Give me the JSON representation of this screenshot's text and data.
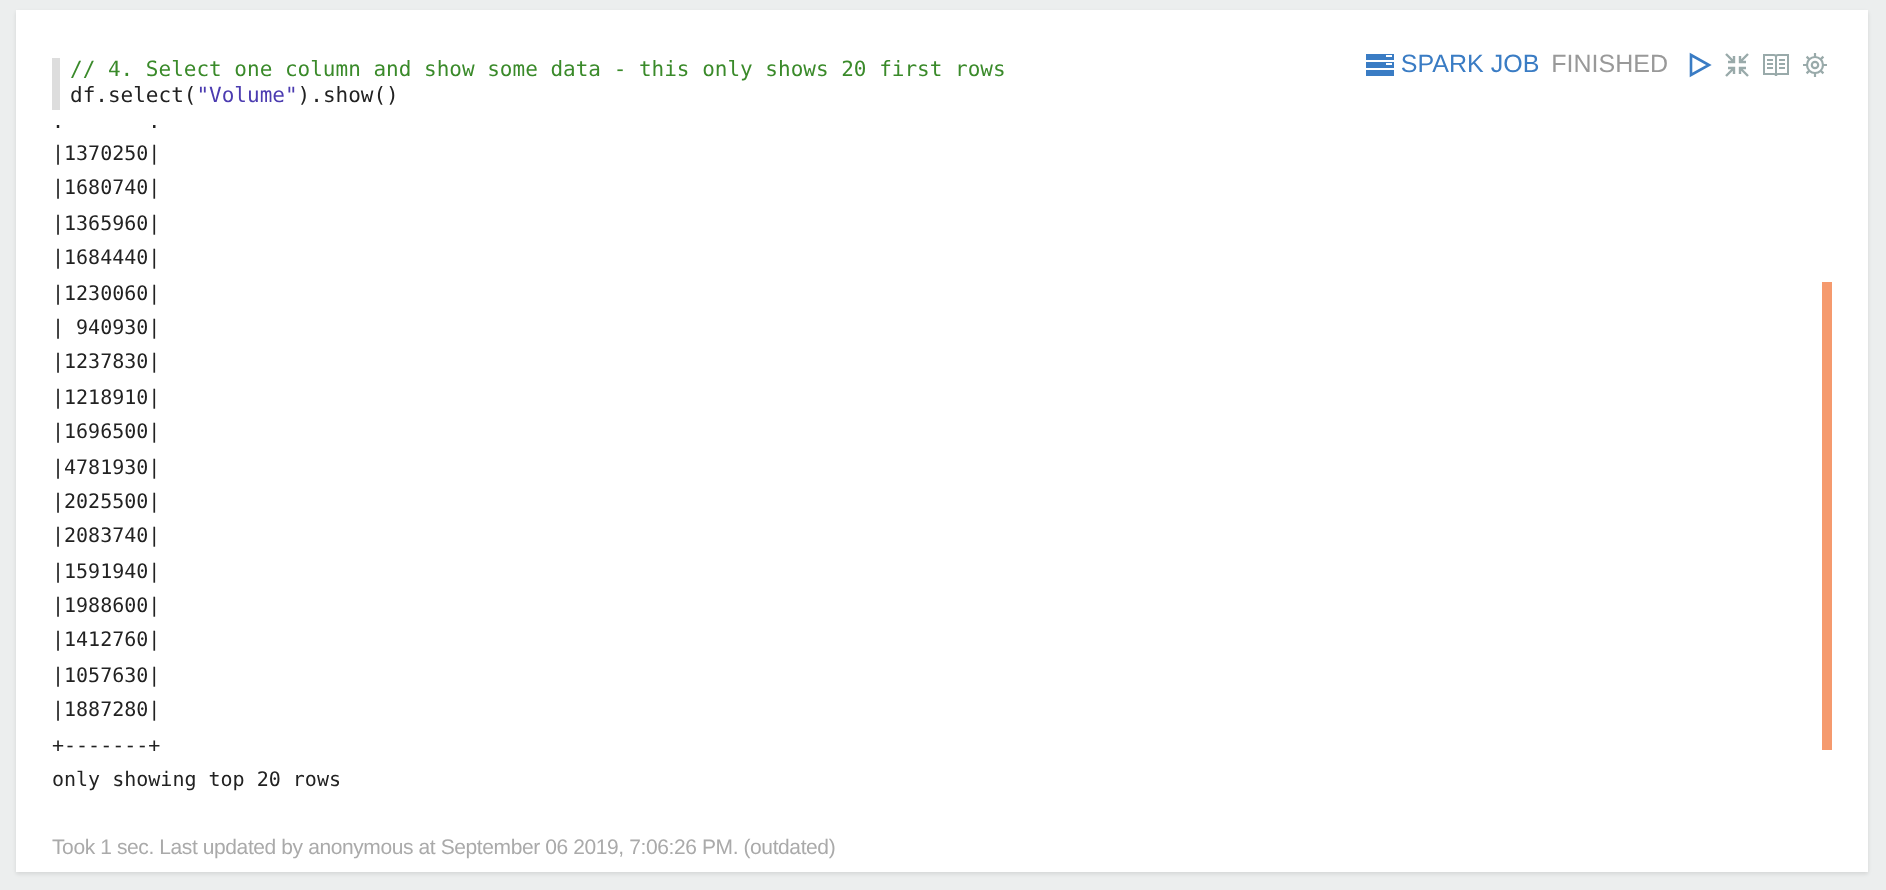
{
  "paragraph": {
    "code": [
      {
        "kind": "comment",
        "text": "// 4. Select one column and show some data - this only shows 20 first rows"
      },
      {
        "kind": "call",
        "before": "df.select(",
        "string": "\"Volume\"",
        "after": ").show()"
      }
    ],
    "status": {
      "job_label": "SPARK JOB",
      "state": "FINISHED"
    },
    "output": {
      "top_border": ".       .",
      "rows": [
        "|1370250|",
        "|1680740|",
        "|1365960|",
        "|1684440|",
        "|1230060|",
        "| 940930|",
        "|1237830|",
        "|1218910|",
        "|1696500|",
        "|4781930|",
        "|2025500|",
        "|2083740|",
        "|1591940|",
        "|1988600|",
        "|1412760|",
        "|1057630|",
        "|1887280|"
      ],
      "bottom_border": "+-------+",
      "note": "only showing top 20 rows"
    },
    "footer": "Took 1 sec. Last updated by anonymous at September 06 2019, 7:06:26 PM. (outdated)"
  }
}
